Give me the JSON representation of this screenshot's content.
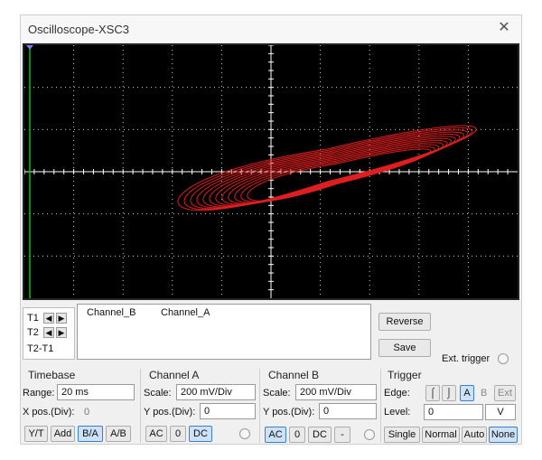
{
  "window": {
    "title": "Oscilloscope-XSC3",
    "close_glyph": "✕"
  },
  "screen": {
    "background": "#000000",
    "grid_color": "#ffffff",
    "trace_color": "#e02020",
    "cursor1_color": "#00c000",
    "trace": {
      "shape": "hysteresis-loop",
      "grid_divs": [
        10,
        6
      ]
    }
  },
  "cursors": {
    "t1_label": "T1",
    "t2_label": "T2",
    "t2t1_label": "T2-T1",
    "left_arrow": "◀",
    "right_arrow": "▶"
  },
  "channels_table": {
    "col1": "Channel_B",
    "col2": "Channel_A"
  },
  "buttons": {
    "reverse": "Reverse",
    "save": "Save",
    "ext_trigger": "Ext. trigger"
  },
  "timebase": {
    "title": "Timebase",
    "range_label": "Range:",
    "range_value": "20 ms",
    "xpos_label": "X pos.(Div):",
    "xpos_value": "0",
    "modes": [
      "Y/T",
      "Add",
      "B/A",
      "A/B"
    ],
    "active_mode": "B/A"
  },
  "channel_a": {
    "title": "Channel A",
    "scale_label": "Scale:",
    "scale_value": "200 mV/Div",
    "ypos_label": "Y pos.(Div):",
    "ypos_value": "0",
    "coupling": [
      "AC",
      "0",
      "DC"
    ],
    "active": "DC"
  },
  "channel_b": {
    "title": "Channel B",
    "scale_label": "Scale:",
    "scale_value": "200 mV/Div",
    "ypos_label": "Y pos.(Div):",
    "ypos_value": "0",
    "coupling": [
      "AC",
      "0",
      "DC",
      "-"
    ],
    "active": "AC"
  },
  "trigger": {
    "title": "Trigger",
    "edge_label": "Edge:",
    "edge_rise": "⌠",
    "edge_fall": "⌡",
    "sources": [
      "A",
      "B",
      "Ext"
    ],
    "active_source": "A",
    "level_label": "Level:",
    "level_value": "0",
    "level_unit": "V",
    "modes": [
      "Single",
      "Normal",
      "Auto",
      "None"
    ],
    "active_mode": "None"
  }
}
